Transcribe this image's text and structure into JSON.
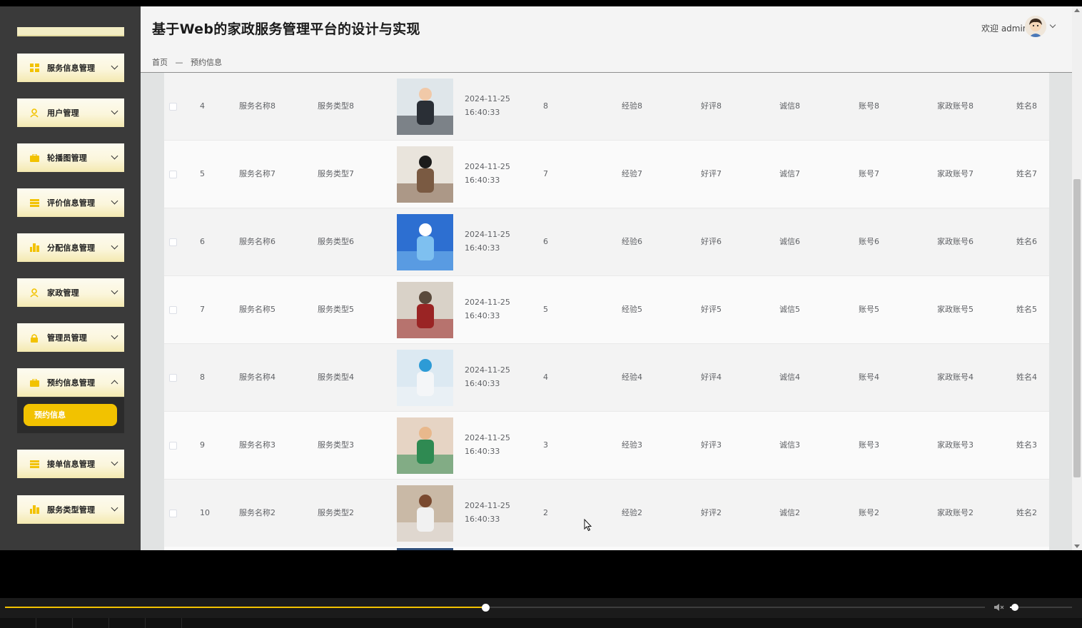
{
  "header": {
    "title": "基于Web的家政服务管理平台的设计与实现",
    "welcome": "欢迎 admin"
  },
  "breadcrumb": {
    "home": "首页",
    "separator": "—",
    "current": "预约信息"
  },
  "sidebar": {
    "items": [
      {
        "label": "服务信息管理",
        "icon": "grid-icon"
      },
      {
        "label": "用户管理",
        "icon": "user-icon"
      },
      {
        "label": "轮播图管理",
        "icon": "briefcase-icon"
      },
      {
        "label": "评价信息管理",
        "icon": "list-icon"
      },
      {
        "label": "分配信息管理",
        "icon": "chart-icon"
      },
      {
        "label": "家政管理",
        "icon": "user-icon"
      },
      {
        "label": "管理员管理",
        "icon": "lock-icon"
      },
      {
        "label": "预约信息管理",
        "icon": "briefcase-icon",
        "expanded": true
      },
      {
        "label": "接单信息管理",
        "icon": "list-icon"
      },
      {
        "label": "服务类型管理",
        "icon": "chart-icon"
      }
    ],
    "submenu": {
      "label": "预约信息"
    }
  },
  "table": {
    "rows": [
      {
        "index": "4",
        "name": "服务名称8",
        "type": "服务类型8",
        "time": "2024-11-25 16:40:33",
        "num": "8",
        "experience": "经验8",
        "review": "好评8",
        "credit": "诚信8",
        "account": "账号8",
        "housekeeper_account": "家政账号8",
        "housekeeper_name": "姓名8"
      },
      {
        "index": "5",
        "name": "服务名称7",
        "type": "服务类型7",
        "time": "2024-11-25 16:40:33",
        "num": "7",
        "experience": "经验7",
        "review": "好评7",
        "credit": "诚信7",
        "account": "账号7",
        "housekeeper_account": "家政账号7",
        "housekeeper_name": "姓名7"
      },
      {
        "index": "6",
        "name": "服务名称6",
        "type": "服务类型6",
        "time": "2024-11-25 16:40:33",
        "num": "6",
        "experience": "经验6",
        "review": "好评6",
        "credit": "诚信6",
        "account": "账号6",
        "housekeeper_account": "家政账号6",
        "housekeeper_name": "姓名6"
      },
      {
        "index": "7",
        "name": "服务名称5",
        "type": "服务类型5",
        "time": "2024-11-25 16:40:33",
        "num": "5",
        "experience": "经验5",
        "review": "好评5",
        "credit": "诚信5",
        "account": "账号5",
        "housekeeper_account": "家政账号5",
        "housekeeper_name": "姓名5"
      },
      {
        "index": "8",
        "name": "服务名称4",
        "type": "服务类型4",
        "time": "2024-11-25 16:40:33",
        "num": "4",
        "experience": "经验4",
        "review": "好评4",
        "credit": "诚信4",
        "account": "账号4",
        "housekeeper_account": "家政账号4",
        "housekeeper_name": "姓名4"
      },
      {
        "index": "9",
        "name": "服务名称3",
        "type": "服务类型3",
        "time": "2024-11-25 16:40:33",
        "num": "3",
        "experience": "经验3",
        "review": "好评3",
        "credit": "诚信3",
        "account": "账号3",
        "housekeeper_account": "家政账号3",
        "housekeeper_name": "姓名3"
      },
      {
        "index": "10",
        "name": "服务名称2",
        "type": "服务类型2",
        "time": "2024-11-25 16:40:33",
        "num": "2",
        "experience": "经验2",
        "review": "好评2",
        "credit": "诚信2",
        "account": "账号2",
        "housekeeper_account": "家政账号2",
        "housekeeper_name": "姓名2"
      }
    ]
  },
  "player": {
    "progress": 0.49,
    "volume": 0.08
  },
  "colors": {
    "accent": "#f2c200",
    "sidebar_bg": "#3a3a3a"
  }
}
